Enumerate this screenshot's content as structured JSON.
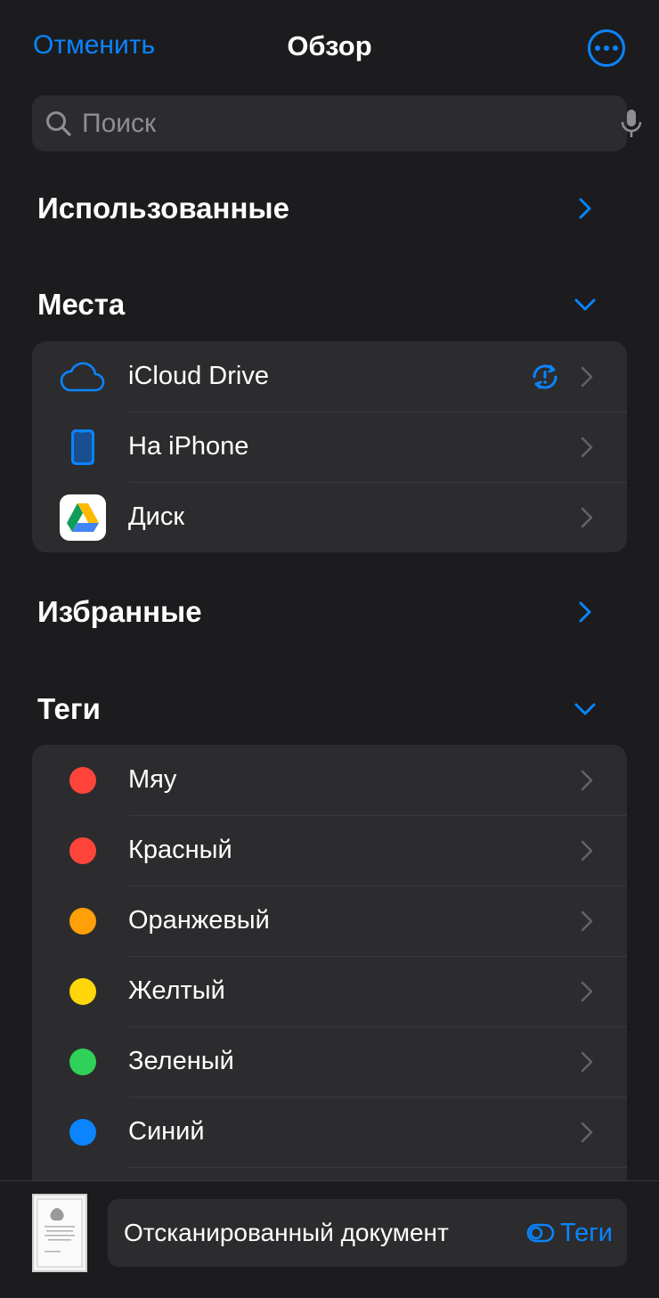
{
  "nav": {
    "cancel_label": "Отменить",
    "title": "Обзор"
  },
  "search": {
    "placeholder": "Поиск"
  },
  "sections": {
    "recents": "Использованные",
    "locations": "Места",
    "favorites": "Избранные",
    "tags": "Теги"
  },
  "locations": [
    {
      "label": "iCloud Drive",
      "icon": "icloud-icon"
    },
    {
      "label": "На iPhone",
      "icon": "iphone-icon"
    },
    {
      "label": "Диск",
      "icon": "google-drive-icon"
    }
  ],
  "tags": [
    {
      "label": "Мяу",
      "color": "#ff453a"
    },
    {
      "label": "Красный",
      "color": "#ff453a"
    },
    {
      "label": "Оранжевый",
      "color": "#ff9f0a"
    },
    {
      "label": "Желтый",
      "color": "#ffd60a"
    },
    {
      "label": "Зеленый",
      "color": "#30d158"
    },
    {
      "label": "Синий",
      "color": "#0a84ff"
    }
  ],
  "bottom": {
    "document_name": "Отсканированный документ",
    "tags_label": "Теги"
  },
  "colors": {
    "accent": "#0a84ff",
    "background": "#1c1c1e",
    "cell": "#2c2c2e"
  }
}
